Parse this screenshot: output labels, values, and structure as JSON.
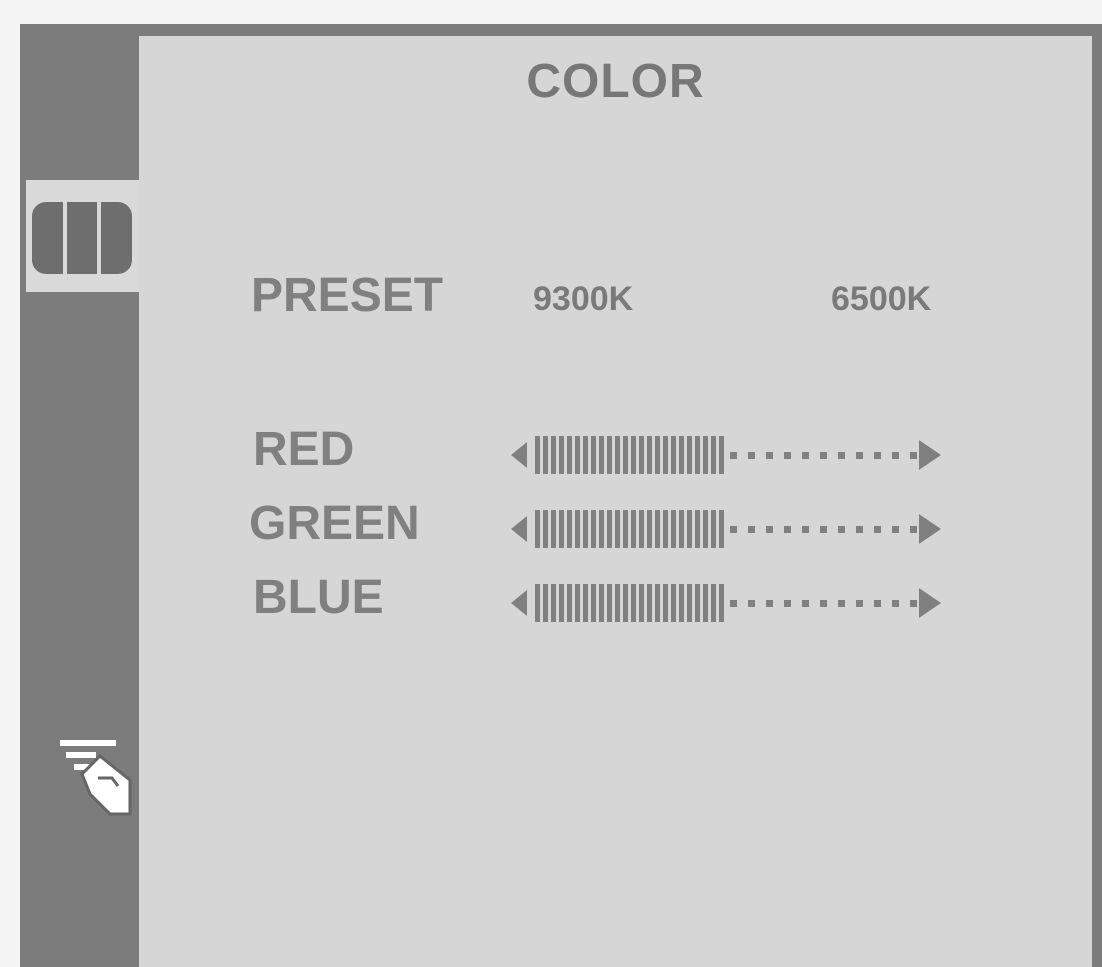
{
  "title": "COLOR",
  "sidebar": {
    "items": [
      {
        "name": "color",
        "icon": "color-bars-icon",
        "active": true
      },
      {
        "name": "exit",
        "icon": "hand-pointer-icon",
        "active": false
      }
    ]
  },
  "preset": {
    "label": "PRESET",
    "options": [
      "9300K",
      "6500K"
    ]
  },
  "channels": [
    {
      "label": "RED",
      "level": 0.5
    },
    {
      "label": "GREEN",
      "level": 0.5
    },
    {
      "label": "BLUE",
      "level": 0.5
    }
  ],
  "colors": {
    "frame": "#7c7c7c",
    "panel": "#d6d6d6",
    "text": "#808080"
  }
}
